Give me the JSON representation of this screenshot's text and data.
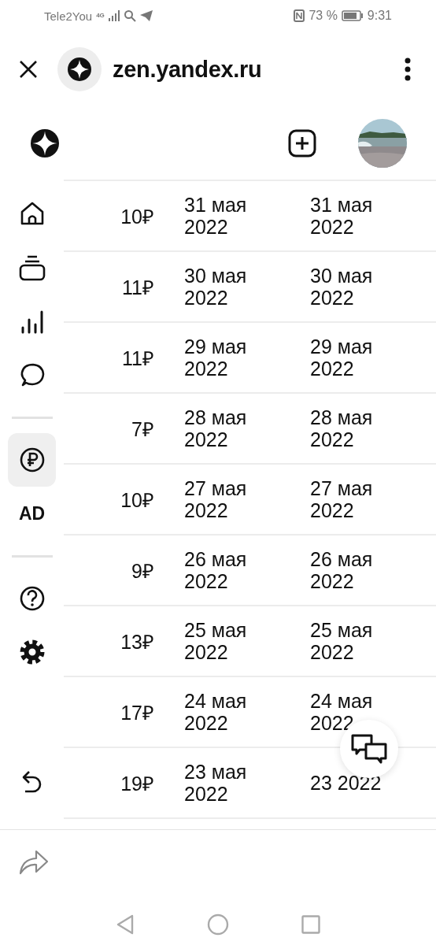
{
  "status_bar": {
    "carrier": "Tele2You",
    "network": "4G",
    "battery": "73 %",
    "time": "9:31"
  },
  "browser_bar": {
    "url": "zen.yandex.ru"
  },
  "sidebar": {
    "items": [
      {
        "kind": "icon",
        "selected": false
      },
      {
        "kind": "icon",
        "selected": false
      },
      {
        "kind": "icon",
        "selected": false
      },
      {
        "kind": "icon",
        "selected": false
      },
      {
        "kind": "divider"
      },
      {
        "kind": "icon",
        "selected": true
      },
      {
        "kind": "text",
        "label": "AD",
        "selected": false
      },
      {
        "kind": "divider"
      },
      {
        "kind": "icon",
        "selected": false
      },
      {
        "kind": "icon",
        "selected": false
      },
      {
        "kind": "icon",
        "selected": false
      }
    ]
  },
  "table": {
    "rows": [
      {
        "amount": "10₽",
        "date_1": "31 мая 2022",
        "date_2": "31 мая 2022"
      },
      {
        "amount": "11₽",
        "date_1": "30 мая 2022",
        "date_2": "30 мая 2022"
      },
      {
        "amount": "11₽",
        "date_1": "29 мая 2022",
        "date_2": "29 мая 2022"
      },
      {
        "amount": "7₽",
        "date_1": "28 мая 2022",
        "date_2": "28 мая 2022"
      },
      {
        "amount": "10₽",
        "date_1": "27 мая 2022",
        "date_2": "27 мая 2022"
      },
      {
        "amount": "9₽",
        "date_1": "26 мая 2022",
        "date_2": "26 мая 2022"
      },
      {
        "amount": "13₽",
        "date_1": "25 мая 2022",
        "date_2": "25 мая 2022"
      },
      {
        "amount": "17₽",
        "date_1": "24 мая 2022",
        "date_2": "24 мая 2022"
      },
      {
        "amount": "19₽",
        "date_1": "23 мая 2022",
        "date_2": "23 2022"
      }
    ]
  }
}
